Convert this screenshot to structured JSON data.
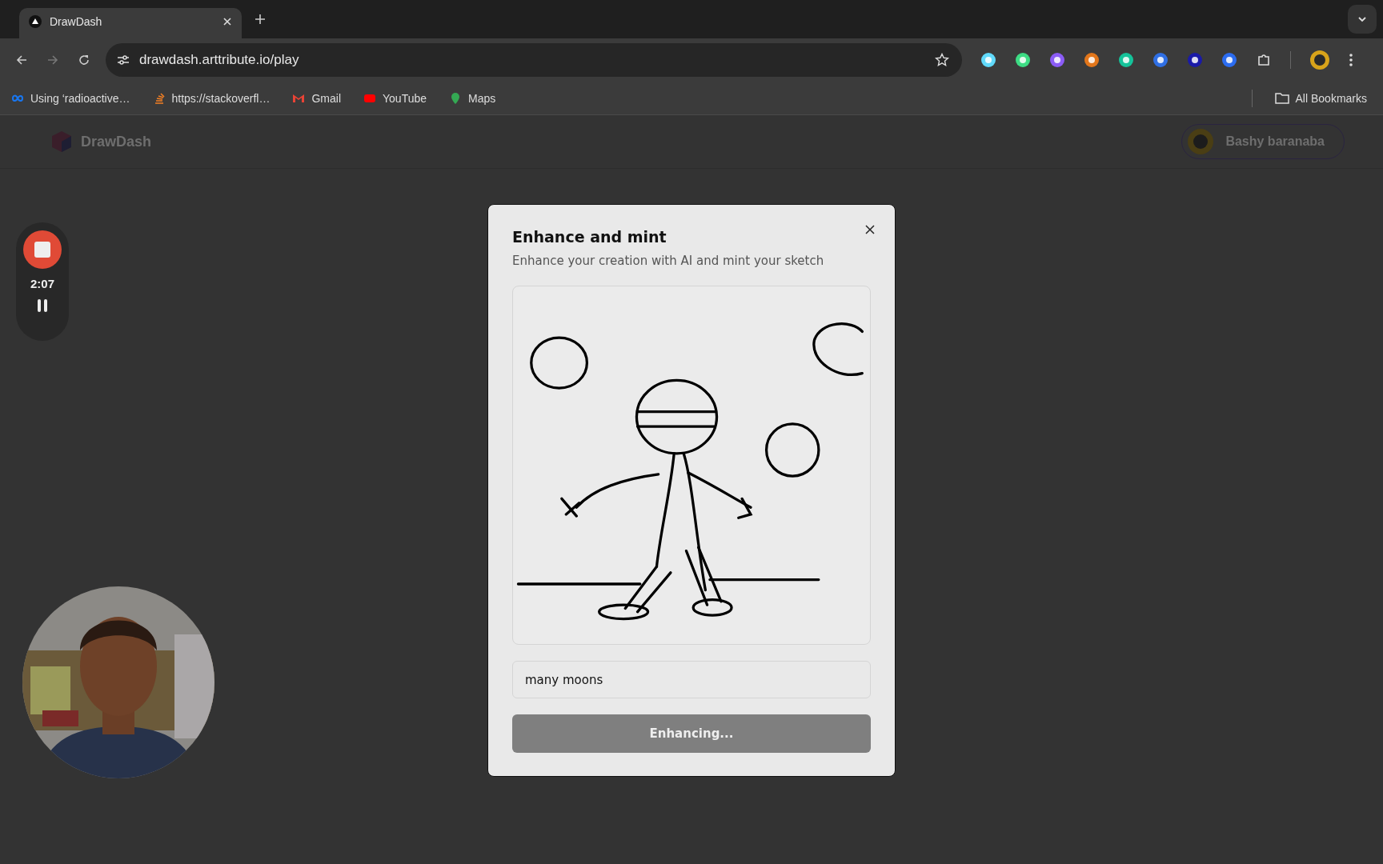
{
  "browser": {
    "tab": {
      "title": "DrawDash"
    },
    "url": "drawdash.arttribute.io/play",
    "bookmarks": [
      {
        "kind": "loop",
        "label": "Using ‘radioactive…"
      },
      {
        "kind": "stack",
        "label": "https://stackoverfl…"
      },
      {
        "kind": "mail",
        "label": "Gmail"
      },
      {
        "kind": "video",
        "label": "YouTube"
      },
      {
        "kind": "pin",
        "label": "Maps"
      }
    ],
    "all_bookmarks": "All Bookmarks"
  },
  "header": {
    "logo": "DrawDash",
    "user": "Bashy baranaba"
  },
  "recorder": {
    "time": "2:07"
  },
  "modal": {
    "title": "Enhance and mint",
    "subtitle": "Enhance your creation with AI and mint your sketch",
    "prompt": {
      "value": "many moons"
    },
    "button": {
      "label": "Enhancing...",
      "disabled": true
    }
  }
}
